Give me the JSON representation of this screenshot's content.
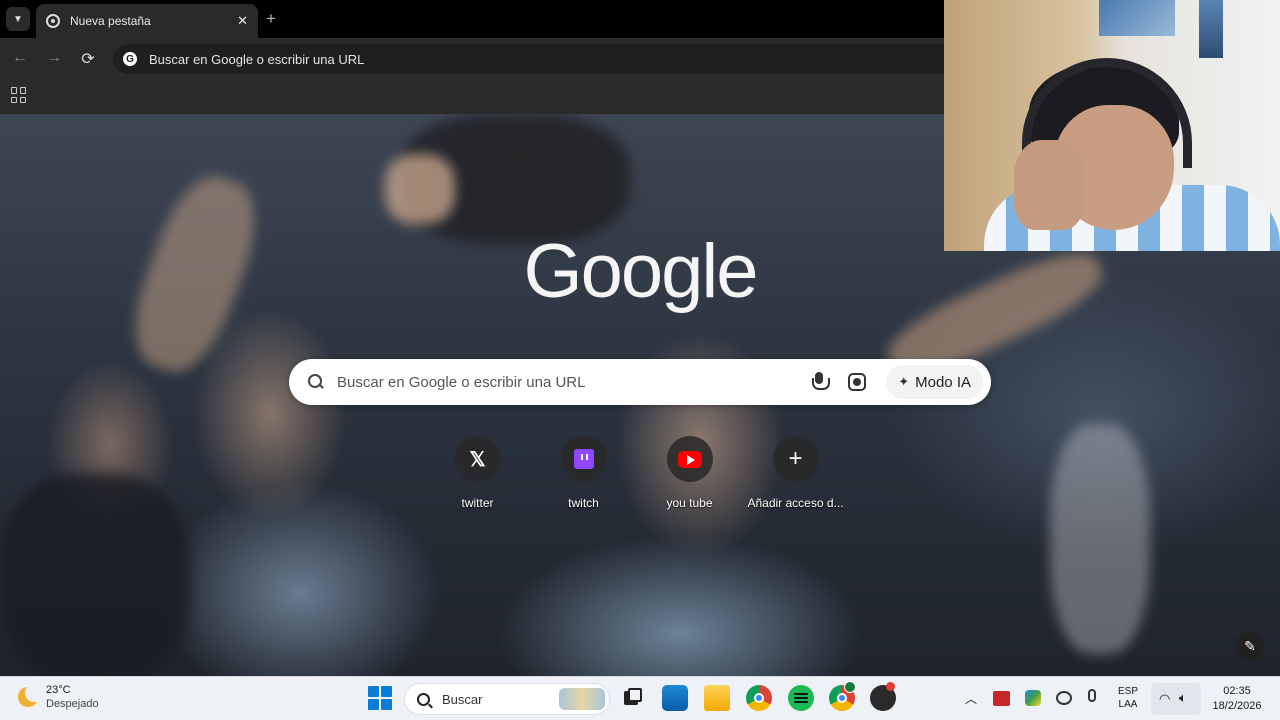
{
  "browser": {
    "tab_title": "Nueva pestaña",
    "tab_close": "✕",
    "new_tab": "+",
    "omnibox_text": "Buscar en Google o escribir una URL",
    "nav": {
      "back": "←",
      "forward": "→",
      "reload": "⟳"
    }
  },
  "ntp": {
    "logo": "Google",
    "search_placeholder": "Buscar en Google o escribir una URL",
    "ai_mode_label": "Modo IA",
    "shortcuts": [
      {
        "label": "twitter",
        "icon": "x-icon"
      },
      {
        "label": "twitch",
        "icon": "twitch-icon"
      },
      {
        "label": "you tube",
        "icon": "youtube-icon"
      },
      {
        "label": "Añadir acceso d...",
        "icon": "plus-icon"
      }
    ],
    "customize_icon": "pencil-icon"
  },
  "taskbar": {
    "weather_temp": "23°C",
    "weather_condition": "Despejado",
    "search_label": "Buscar",
    "language_top": "ESP",
    "language_bottom": "LAA",
    "time": "02:35",
    "date": "18/2/2026",
    "pinned_apps": [
      "task-view",
      "microsoft-store",
      "file-explorer",
      "chrome",
      "spotify",
      "chrome-profile",
      "obs"
    ],
    "tray": [
      "chevron-up",
      "app-red",
      "app-color",
      "network-off",
      "microphone",
      "wifi",
      "volume"
    ]
  }
}
